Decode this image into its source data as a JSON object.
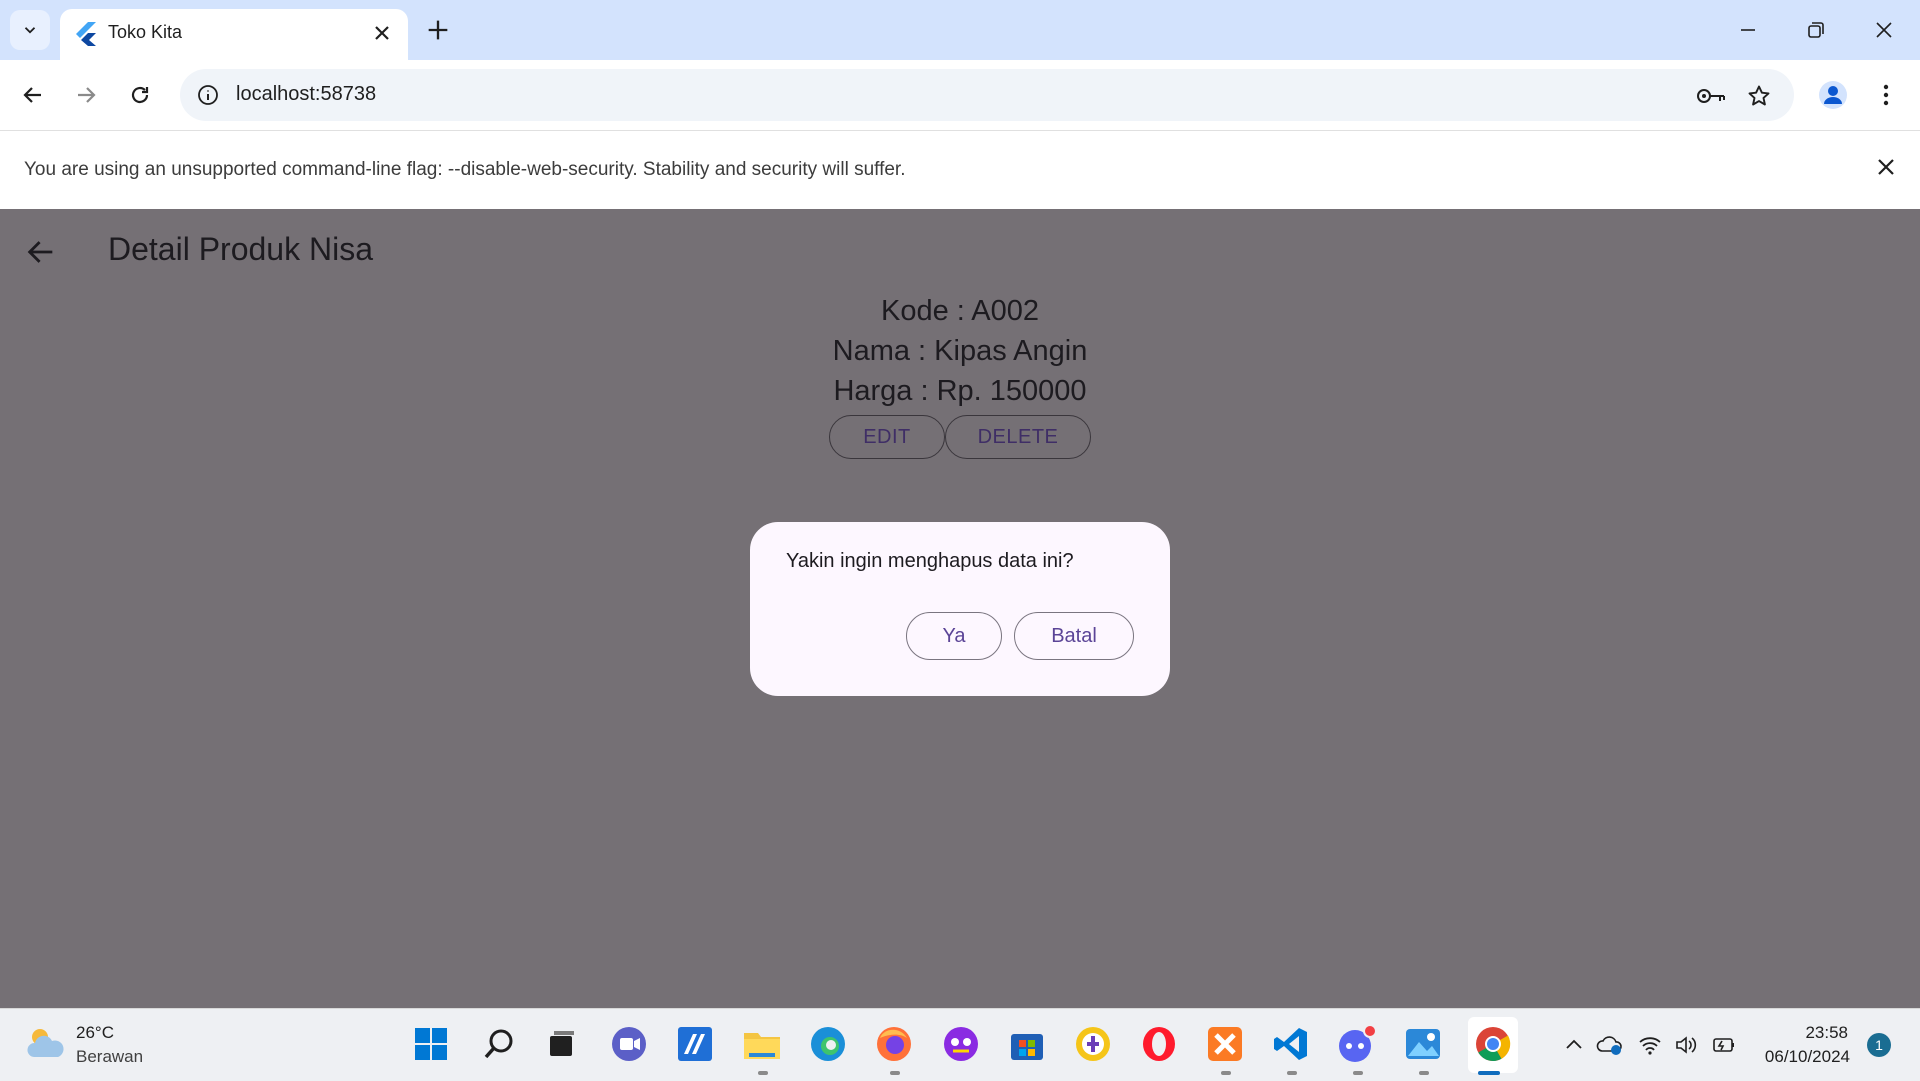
{
  "browser": {
    "tab_title": "Toko Kita",
    "url": "localhost:58738",
    "infobar_message": "You are using an unsupported command-line flag: --disable-web-security. Stability and security will suffer."
  },
  "app": {
    "title": "Detail Produk Nisa",
    "kode": "Kode : A002",
    "nama": "Nama : Kipas Angin",
    "harga": "Harga : Rp. 150000",
    "edit_label": "EDIT",
    "delete_label": "DELETE"
  },
  "dialog": {
    "message": "Yakin ingin menghapus data ini?",
    "yes_label": "Ya",
    "cancel_label": "Batal"
  },
  "taskbar": {
    "weather_temp": "26°C",
    "weather_condition": "Berawan",
    "time": "23:58",
    "date": "06/10/2024",
    "notification_count": "1",
    "apps": [
      "start-icon",
      "search-icon",
      "task-view-icon",
      "meet-icon",
      "app-icon",
      "file-explorer-icon",
      "edge-icon",
      "firefox-icon",
      "app-icon",
      "store-icon",
      "app-icon",
      "opera-icon",
      "xampp-icon",
      "vscode-icon",
      "discord-icon",
      "photos-icon",
      "chrome-icon"
    ]
  },
  "colors": {
    "tabstrip": "#d3e3fd",
    "scrim": "#757075",
    "dialog_bg": "#fdf7ff",
    "button_text": "#5b4497"
  }
}
